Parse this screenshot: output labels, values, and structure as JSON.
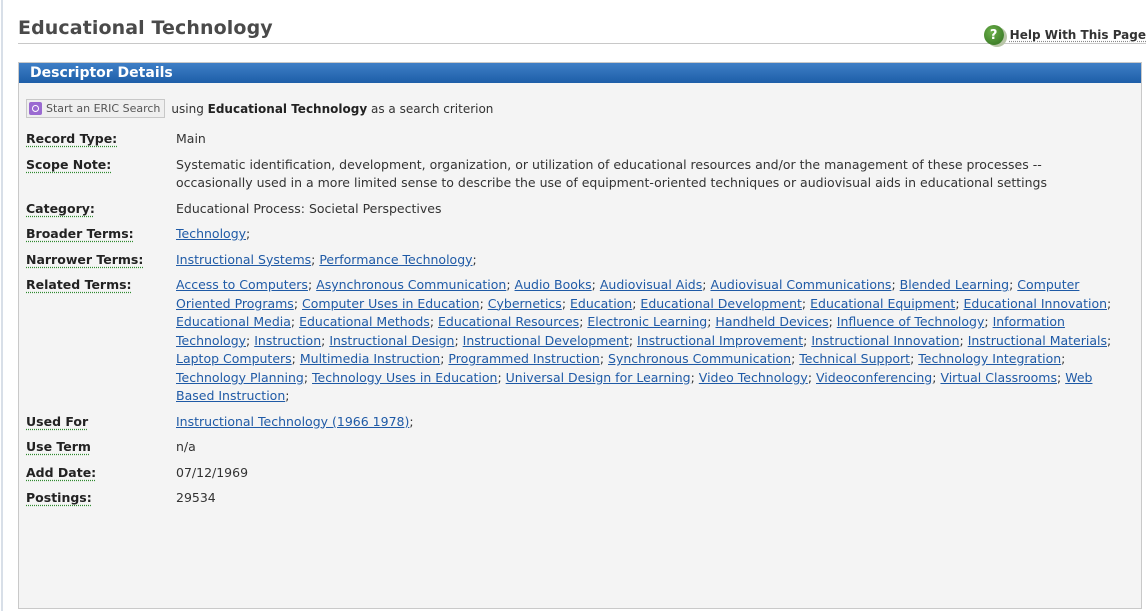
{
  "header": {
    "title": "Educational Technology",
    "help_label": "Help With This Page",
    "help_icon": "?"
  },
  "panel": {
    "title": "Descriptor Details"
  },
  "search": {
    "button_label": "Start an ERIC Search",
    "text_prefix": "using",
    "term": "Educational Technology",
    "text_suffix": "as a search criterion"
  },
  "labels": {
    "record_type": "Record Type:",
    "scope_note": "Scope Note:",
    "category": "Category:",
    "broader_terms": "Broader Terms:",
    "narrower_terms": "Narrower Terms:",
    "related_terms": "Related Terms:",
    "used_for": "Used For",
    "use_term": "Use Term",
    "add_date": "Add Date:",
    "postings": "Postings:"
  },
  "values": {
    "record_type": "Main",
    "scope_note": "Systematic identification, development, organization, or utilization of educational resources and/or the management of these processes -- occasionally used in a more limited sense to describe the use of equipment-oriented techniques or audiovisual aids in educational settings",
    "category": "Educational Process: Societal Perspectives",
    "use_term": "n/a",
    "add_date": "07/12/1969",
    "postings": "29534"
  },
  "broader_terms": [
    "Technology"
  ],
  "narrower_terms": [
    "Instructional Systems",
    "Performance Technology"
  ],
  "related_terms": [
    "Access to Computers",
    "Asynchronous Communication",
    "Audio Books",
    "Audiovisual Aids",
    "Audiovisual Communications",
    "Blended Learning",
    "Computer Oriented Programs",
    "Computer Uses in Education",
    "Cybernetics",
    "Education",
    "Educational Development",
    "Educational Equipment",
    "Educational Innovation",
    "Educational Media",
    "Educational Methods",
    "Educational Resources",
    "Electronic Learning",
    "Handheld Devices",
    "Influence of Technology",
    "Information Technology",
    "Instruction",
    "Instructional Design",
    "Instructional Development",
    "Instructional Improvement",
    "Instructional Innovation",
    "Instructional Materials",
    "Laptop Computers",
    "Multimedia Instruction",
    "Programmed Instruction",
    "Synchronous Communication",
    "Technical Support",
    "Technology Integration",
    "Technology Planning",
    "Technology Uses in Education",
    "Universal Design for Learning",
    "Video Technology",
    "Videoconferencing",
    "Virtual Classrooms",
    "Web Based Instruction"
  ],
  "used_for": [
    "Instructional Technology (1966 1978)"
  ],
  "term_separator": ";",
  "colors": {
    "panel_header": "#1d5ea8",
    "link": "#1f5aa6",
    "label_underline": "#2f8a2f"
  },
  "icons": {
    "help": "help-icon",
    "search": "search-icon"
  }
}
